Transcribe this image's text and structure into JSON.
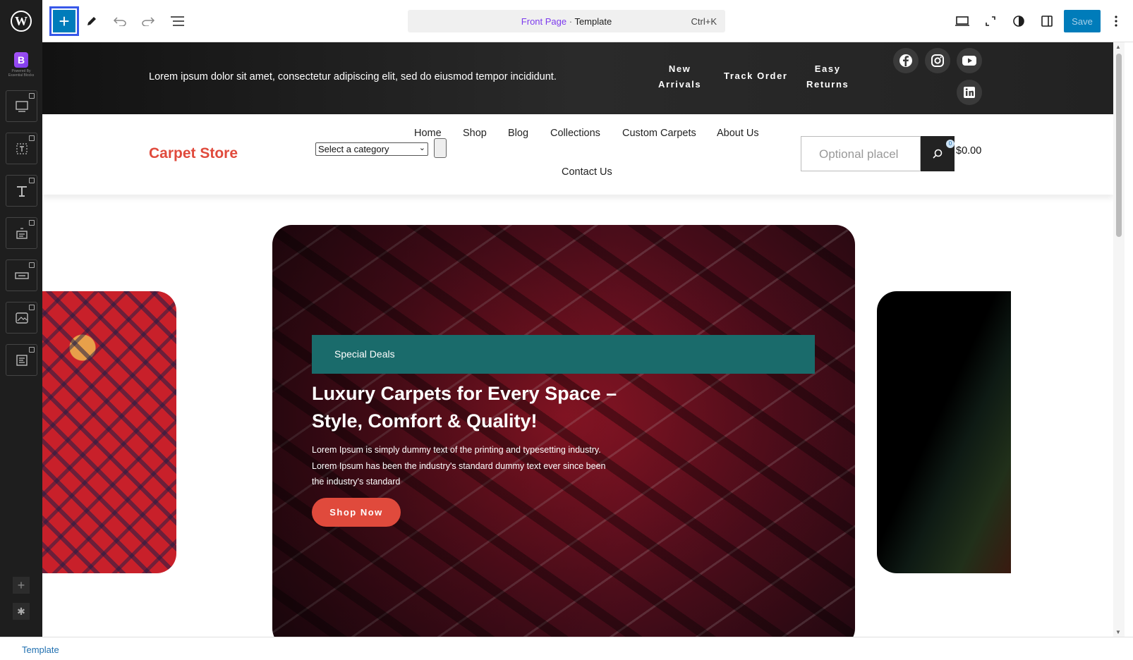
{
  "toolbar": {
    "document_page": "Front Page",
    "document_separator": " · ",
    "document_type": "Template",
    "shortcut": "Ctrl+K",
    "save_label": "Save",
    "add_label": "+"
  },
  "sidebar": {
    "powered_by": "Powered By Essential Blocks",
    "items": [
      "slider-block",
      "text-block",
      "heading-block",
      "form-block",
      "button-block",
      "image-block",
      "list-block"
    ]
  },
  "site": {
    "top_message": "Lorem ipsum dolor sit amet, consectetur adipiscing elit, sed do eiusmod tempor incididunt.",
    "top_links": [
      {
        "line1": "New",
        "line2": "Arrivals"
      },
      {
        "line1": "Track Order",
        "line2": ""
      },
      {
        "line1": "Easy",
        "line2": "Returns"
      }
    ],
    "social": [
      "facebook-icon",
      "instagram-icon",
      "youtube-icon",
      "linkedin-icon"
    ],
    "brand": "Carpet Store",
    "category_placeholder": "Select a category",
    "nav": [
      "Home",
      "Shop",
      "Blog",
      "Collections",
      "Custom Carpets",
      "About Us",
      "Contact Us"
    ],
    "search_placeholder": "Optional placel",
    "cart_total": "$0.00",
    "cart_count": "0"
  },
  "hero": {
    "deals": "Special Deals",
    "title": "Luxury Carpets for Every Space – Style, Comfort & Quality!",
    "text": "Lorem Ipsum is simply dummy text of the printing and typesetting industry. Lorem Ipsum has been the industry's standard dummy text  ever since been the industry's standard",
    "button": "Shop Now"
  },
  "footer": {
    "breadcrumb": "Template"
  },
  "colors": {
    "wp_blue": "#007cba",
    "brand_red": "#e04a3c",
    "teal": "#1a6b6b",
    "dark": "#1e1e1e"
  }
}
